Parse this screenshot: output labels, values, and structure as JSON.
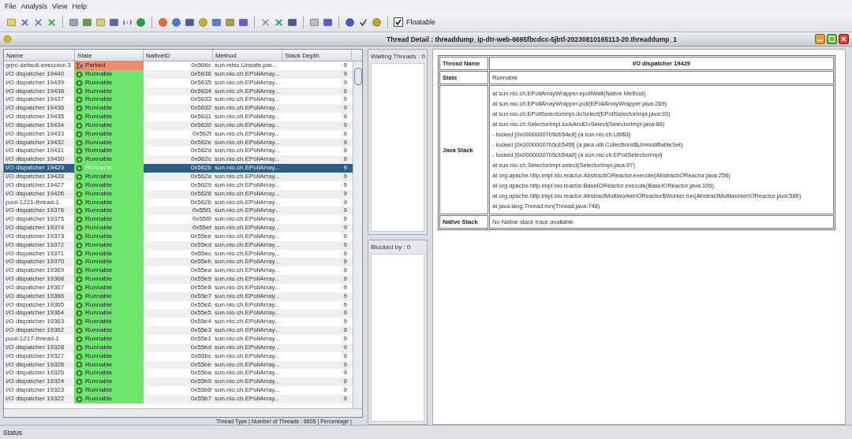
{
  "menu": [
    "File",
    "Analysis",
    "View",
    "Help"
  ],
  "toolbar": {
    "floatable": {
      "label": "Floatable",
      "checked": true
    }
  },
  "window": {
    "title": "Thread Detail : threaddump_ip-dtr-web-6695fbcdcc-5jbtf-20230810165113-20.threaddump_1"
  },
  "table": {
    "columns": [
      "Name",
      "State",
      "NativeID",
      "Method",
      "Stack Depth"
    ],
    "rows": [
      {
        "name": "grpc-default-executor-3",
        "state": "Parked",
        "kind": "parked",
        "native_id": "0x566c",
        "method": "sun.misc.Unsafe.par...",
        "depth": "9",
        "selected": false
      },
      {
        "name": "I/O dispatcher 19440",
        "state": "Runnable",
        "kind": "runnable",
        "native_id": "0x5636",
        "method": "sun.nio.ch.EPollArray...",
        "depth": "9",
        "selected": false
      },
      {
        "name": "I/O dispatcher 19439",
        "state": "Runnable",
        "kind": "runnable",
        "native_id": "0x5635",
        "method": "sun.nio.ch.EPollArray...",
        "depth": "9",
        "selected": false
      },
      {
        "name": "I/O dispatcher 19438",
        "state": "Runnable",
        "kind": "runnable",
        "native_id": "0x5634",
        "method": "sun.nio.ch.EPollArray...",
        "depth": "9",
        "selected": false
      },
      {
        "name": "I/O dispatcher 19437",
        "state": "Runnable",
        "kind": "runnable",
        "native_id": "0x5633",
        "method": "sun.nio.ch.EPollArray...",
        "depth": "9",
        "selected": false
      },
      {
        "name": "I/O dispatcher 19436",
        "state": "Runnable",
        "kind": "runnable",
        "native_id": "0x5632",
        "method": "sun.nio.ch.EPollArray...",
        "depth": "9",
        "selected": false
      },
      {
        "name": "I/O dispatcher 19435",
        "state": "Runnable",
        "kind": "runnable",
        "native_id": "0x5631",
        "method": "sun.nio.ch.EPollArray...",
        "depth": "9",
        "selected": false
      },
      {
        "name": "I/O dispatcher 19434",
        "state": "Runnable",
        "kind": "runnable",
        "native_id": "0x5630",
        "method": "sun.nio.ch.EPollArray...",
        "depth": "9",
        "selected": false
      },
      {
        "name": "I/O dispatcher 19433",
        "state": "Runnable",
        "kind": "runnable",
        "native_id": "0x562f",
        "method": "sun.nio.ch.EPollArray...",
        "depth": "9",
        "selected": false
      },
      {
        "name": "I/O dispatcher 19432",
        "state": "Runnable",
        "kind": "runnable",
        "native_id": "0x562e",
        "method": "sun.nio.ch.EPollArray...",
        "depth": "9",
        "selected": false
      },
      {
        "name": "I/O dispatcher 19431",
        "state": "Runnable",
        "kind": "runnable",
        "native_id": "0x562d",
        "method": "sun.nio.ch.EPollArray...",
        "depth": "9",
        "selected": false
      },
      {
        "name": "I/O dispatcher 19430",
        "state": "Runnable",
        "kind": "runnable",
        "native_id": "0x562c",
        "method": "sun.nio.ch.EPollArray...",
        "depth": "9",
        "selected": false
      },
      {
        "name": "I/O dispatcher 19429",
        "state": "Runnable",
        "kind": "runnable",
        "native_id": "0x562b",
        "method": "sun.nio.ch.EPollArray...",
        "depth": "9",
        "selected": true
      },
      {
        "name": "I/O dispatcher 19428",
        "state": "Runnable",
        "kind": "runnable",
        "native_id": "0x562a",
        "method": "sun.nio.ch.EPollArray...",
        "depth": "9",
        "selected": false
      },
      {
        "name": "I/O dispatcher 19427",
        "state": "Runnable",
        "kind": "runnable",
        "native_id": "0x5629",
        "method": "sun.nio.ch.EPollArray...",
        "depth": "9",
        "selected": false
      },
      {
        "name": "I/O dispatcher 19426",
        "state": "Runnable",
        "kind": "runnable",
        "native_id": "0x5628",
        "method": "sun.nio.ch.EPollArray...",
        "depth": "9",
        "selected": false
      },
      {
        "name": "pool-1221-thread-1",
        "state": "Runnable",
        "kind": "runnable",
        "native_id": "0x5626",
        "method": "sun.nio.ch.EPollArray...",
        "depth": "9",
        "selected": false
      },
      {
        "name": "I/O dispatcher 19376",
        "state": "Runnable",
        "kind": "runnable",
        "native_id": "0x55f1",
        "method": "sun.nio.ch.EPollArray...",
        "depth": "9",
        "selected": false
      },
      {
        "name": "I/O dispatcher 19375",
        "state": "Runnable",
        "kind": "runnable",
        "native_id": "0x55f0",
        "method": "sun.nio.ch.EPollArray...",
        "depth": "9",
        "selected": false
      },
      {
        "name": "I/O dispatcher 19374",
        "state": "Runnable",
        "kind": "runnable",
        "native_id": "0x55ef",
        "method": "sun.nio.ch.EPollArray...",
        "depth": "9",
        "selected": false
      },
      {
        "name": "I/O dispatcher 19373",
        "state": "Runnable",
        "kind": "runnable",
        "native_id": "0x55ee",
        "method": "sun.nio.ch.EPollArray...",
        "depth": "9",
        "selected": false
      },
      {
        "name": "I/O dispatcher 19372",
        "state": "Runnable",
        "kind": "runnable",
        "native_id": "0x55ed",
        "method": "sun.nio.ch.EPollArray...",
        "depth": "9",
        "selected": false
      },
      {
        "name": "I/O dispatcher 19371",
        "state": "Runnable",
        "kind": "runnable",
        "native_id": "0x55ec",
        "method": "sun.nio.ch.EPollArray...",
        "depth": "9",
        "selected": false
      },
      {
        "name": "I/O dispatcher 19370",
        "state": "Runnable",
        "kind": "runnable",
        "native_id": "0x55eb",
        "method": "sun.nio.ch.EPollArray...",
        "depth": "9",
        "selected": false
      },
      {
        "name": "I/O dispatcher 19369",
        "state": "Runnable",
        "kind": "runnable",
        "native_id": "0x55ea",
        "method": "sun.nio.ch.EPollArray...",
        "depth": "9",
        "selected": false
      },
      {
        "name": "I/O dispatcher 19368",
        "state": "Runnable",
        "kind": "runnable",
        "native_id": "0x55e9",
        "method": "sun.nio.ch.EPollArray...",
        "depth": "9",
        "selected": false
      },
      {
        "name": "I/O dispatcher 19367",
        "state": "Runnable",
        "kind": "runnable",
        "native_id": "0x55e8",
        "method": "sun.nio.ch.EPollArray...",
        "depth": "9",
        "selected": false
      },
      {
        "name": "I/O dispatcher 19366",
        "state": "Runnable",
        "kind": "runnable",
        "native_id": "0x55e7",
        "method": "sun.nio.ch.EPollArray...",
        "depth": "9",
        "selected": false
      },
      {
        "name": "I/O dispatcher 19365",
        "state": "Runnable",
        "kind": "runnable",
        "native_id": "0x55e6",
        "method": "sun.nio.ch.EPollArray...",
        "depth": "9",
        "selected": false
      },
      {
        "name": "I/O dispatcher 19364",
        "state": "Runnable",
        "kind": "runnable",
        "native_id": "0x55e5",
        "method": "sun.nio.ch.EPollArray...",
        "depth": "9",
        "selected": false
      },
      {
        "name": "I/O dispatcher 19363",
        "state": "Runnable",
        "kind": "runnable",
        "native_id": "0x55e4",
        "method": "sun.nio.ch.EPollArray...",
        "depth": "9",
        "selected": false
      },
      {
        "name": "I/O dispatcher 19362",
        "state": "Runnable",
        "kind": "runnable",
        "native_id": "0x55e3",
        "method": "sun.nio.ch.EPollArray...",
        "depth": "9",
        "selected": false
      },
      {
        "name": "pool-1217-thread-1",
        "state": "Runnable",
        "kind": "runnable",
        "native_id": "0x55e1",
        "method": "sun.nio.ch.EPollArray...",
        "depth": "9",
        "selected": false
      },
      {
        "name": "I/O dispatcher 19328",
        "state": "Runnable",
        "kind": "runnable",
        "native_id": "0x55bd",
        "method": "sun.nio.ch.EPollArray...",
        "depth": "9",
        "selected": false
      },
      {
        "name": "I/O dispatcher 19327",
        "state": "Runnable",
        "kind": "runnable",
        "native_id": "0x55bc",
        "method": "sun.nio.ch.EPollArray...",
        "depth": "9",
        "selected": false
      },
      {
        "name": "I/O dispatcher 19326",
        "state": "Runnable",
        "kind": "runnable",
        "native_id": "0x55bb",
        "method": "sun.nio.ch.EPollArray...",
        "depth": "9",
        "selected": false
      },
      {
        "name": "I/O dispatcher 19325",
        "state": "Runnable",
        "kind": "runnable",
        "native_id": "0x55ba",
        "method": "sun.nio.ch.EPollArray...",
        "depth": "9",
        "selected": false
      },
      {
        "name": "I/O dispatcher 19324",
        "state": "Runnable",
        "kind": "runnable",
        "native_id": "0x55b9",
        "method": "sun.nio.ch.EPollArray...",
        "depth": "9",
        "selected": false
      },
      {
        "name": "I/O dispatcher 19323",
        "state": "Runnable",
        "kind": "runnable",
        "native_id": "0x55b8",
        "method": "sun.nio.ch.EPollArray...",
        "depth": "9",
        "selected": false
      },
      {
        "name": "I/O dispatcher 19322",
        "state": "Runnable",
        "kind": "runnable",
        "native_id": "0x55b7",
        "method": "sun.nio.ch.EPollArray...",
        "depth": "9",
        "selected": false
      }
    ]
  },
  "summary": "Thread Type | Number of Threads : 6605 | Percentage |",
  "waiting": {
    "label": "Waiting Threads : 0"
  },
  "blocked": {
    "label": "Blocked by : 0"
  },
  "detail": {
    "thread_name": {
      "label": "Thread Name",
      "value": "I/O dispatcher 19429"
    },
    "state": {
      "label": "State",
      "value": "Runnable"
    },
    "java_stack": {
      "label": "Java Stack",
      "lines": [
        "at sun.nio.ch.EPollArrayWrapper.epollWait(Native Method)",
        "at sun.nio.ch.EPollArrayWrapper.poll(EPollArrayWrapper.java:269)",
        "at sun.nio.ch.EPollSelectorImpl.doSelect(EPollSelectorImpl.java:93)",
        "at sun.nio.ch.SelectorImpl.lockAndDoSelect(SelectorImpl.java:86)",
        "- locked [0x00000007b5cb54e8] (a sun.nio.ch.Util$3)",
        "- locked [0x00000007b5cb54f8] (a java.util.Collections$UnmodifiableSet)",
        "- locked [0x00000007b5cb54a0] (a sun.nio.ch.EPollSelectorImpl)",
        "at sun.nio.ch.SelectorImpl.select(SelectorImpl.java:97)",
        "at org.apache.http.impl.nio.reactor.AbstractIOReactor.execute(AbstractIOReactor.java:256)",
        "at org.apache.http.impl.nio.reactor.BaseIOReactor.execute(BaseIOReactor.java:105)",
        "at org.apache.http.impl.nio.reactor.AbstractMultiworkerIOReactor$Worker.run(AbstractMultiworkerIOReactor.java:586)",
        "at java.lang.Thread.run(Thread.java:748)"
      ]
    },
    "native_stack": {
      "label": "Native Stack",
      "value": "No Native stack trace available"
    }
  },
  "status_bar": "Status"
}
